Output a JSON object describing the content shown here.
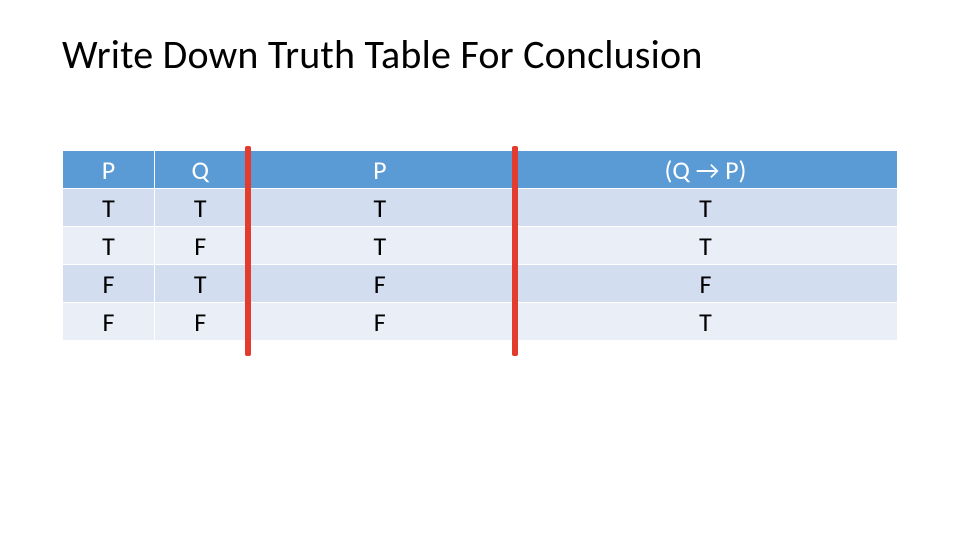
{
  "title": "Write Down Truth Table For Conclusion",
  "table": {
    "headers": [
      "P",
      "Q",
      "P",
      "(Q → P)"
    ],
    "rows": [
      [
        "T",
        "T",
        "T",
        "T"
      ],
      [
        "T",
        "F",
        "T",
        "T"
      ],
      [
        "F",
        "T",
        "F",
        "F"
      ],
      [
        "F",
        "F",
        "F",
        "T"
      ]
    ]
  },
  "chart_data": {
    "type": "table",
    "title": "Write Down Truth Table For Conclusion",
    "columns": [
      "P",
      "Q",
      "P",
      "(Q → P)"
    ],
    "rows": [
      {
        "P": "T",
        "Q": "T",
        "P_copy": "T",
        "Q_imp_P": "T"
      },
      {
        "P": "T",
        "Q": "F",
        "P_copy": "T",
        "Q_imp_P": "T"
      },
      {
        "P": "F",
        "Q": "T",
        "P_copy": "F",
        "Q_imp_P": "F"
      },
      {
        "P": "F",
        "Q": "F",
        "P_copy": "F",
        "Q_imp_P": "T"
      }
    ],
    "separators_after_column_index": [
      1,
      2
    ]
  }
}
